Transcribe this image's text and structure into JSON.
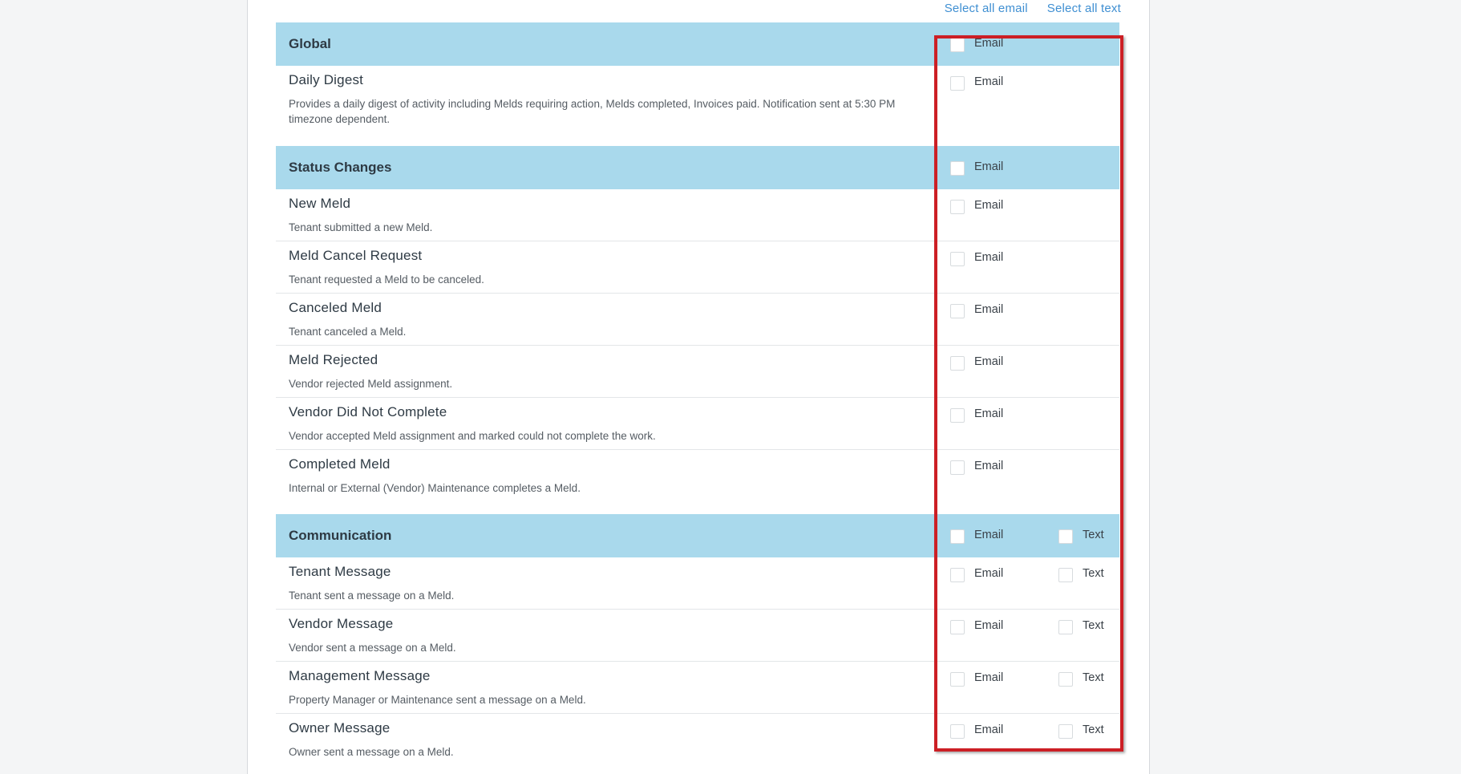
{
  "links": {
    "select_all_email": "Select all email",
    "select_all_text": "Select all text"
  },
  "labels": {
    "email": "Email",
    "text": "Text"
  },
  "sections": {
    "global": {
      "title": "Global",
      "rows": {
        "daily_digest": {
          "title": "Daily Digest",
          "desc": "Provides a daily digest of activity including Melds requiring action, Melds completed, Invoices paid. Notification sent at 5:30 PM timezone dependent."
        }
      }
    },
    "status": {
      "title": "Status Changes",
      "rows": {
        "new_meld": {
          "title": "New Meld",
          "desc": "Tenant submitted a new Meld."
        },
        "cancel_request": {
          "title": "Meld Cancel Request",
          "desc": "Tenant requested a Meld to be canceled."
        },
        "canceled": {
          "title": "Canceled Meld",
          "desc": "Tenant canceled a Meld."
        },
        "rejected": {
          "title": "Meld Rejected",
          "desc": "Vendor rejected Meld assignment."
        },
        "did_not_complete": {
          "title": "Vendor Did Not Complete",
          "desc": "Vendor accepted Meld assignment and marked could not complete the work."
        },
        "completed": {
          "title": "Completed Meld",
          "desc": "Internal or External (Vendor) Maintenance completes a Meld."
        }
      }
    },
    "communication": {
      "title": "Communication",
      "rows": {
        "tenant": {
          "title": "Tenant Message",
          "desc": "Tenant sent a message on a Meld."
        },
        "vendor": {
          "title": "Vendor Message",
          "desc": "Vendor sent a message on a Meld."
        },
        "management": {
          "title": "Management Message",
          "desc": "Property Manager or Maintenance sent a message on a Meld."
        },
        "owner": {
          "title": "Owner Message",
          "desc": "Owner sent a message on a Meld."
        }
      }
    }
  },
  "colors": {
    "header_bg": "#a9d9ec",
    "link": "#3f8fd2",
    "highlight_border": "#cc1f25"
  }
}
